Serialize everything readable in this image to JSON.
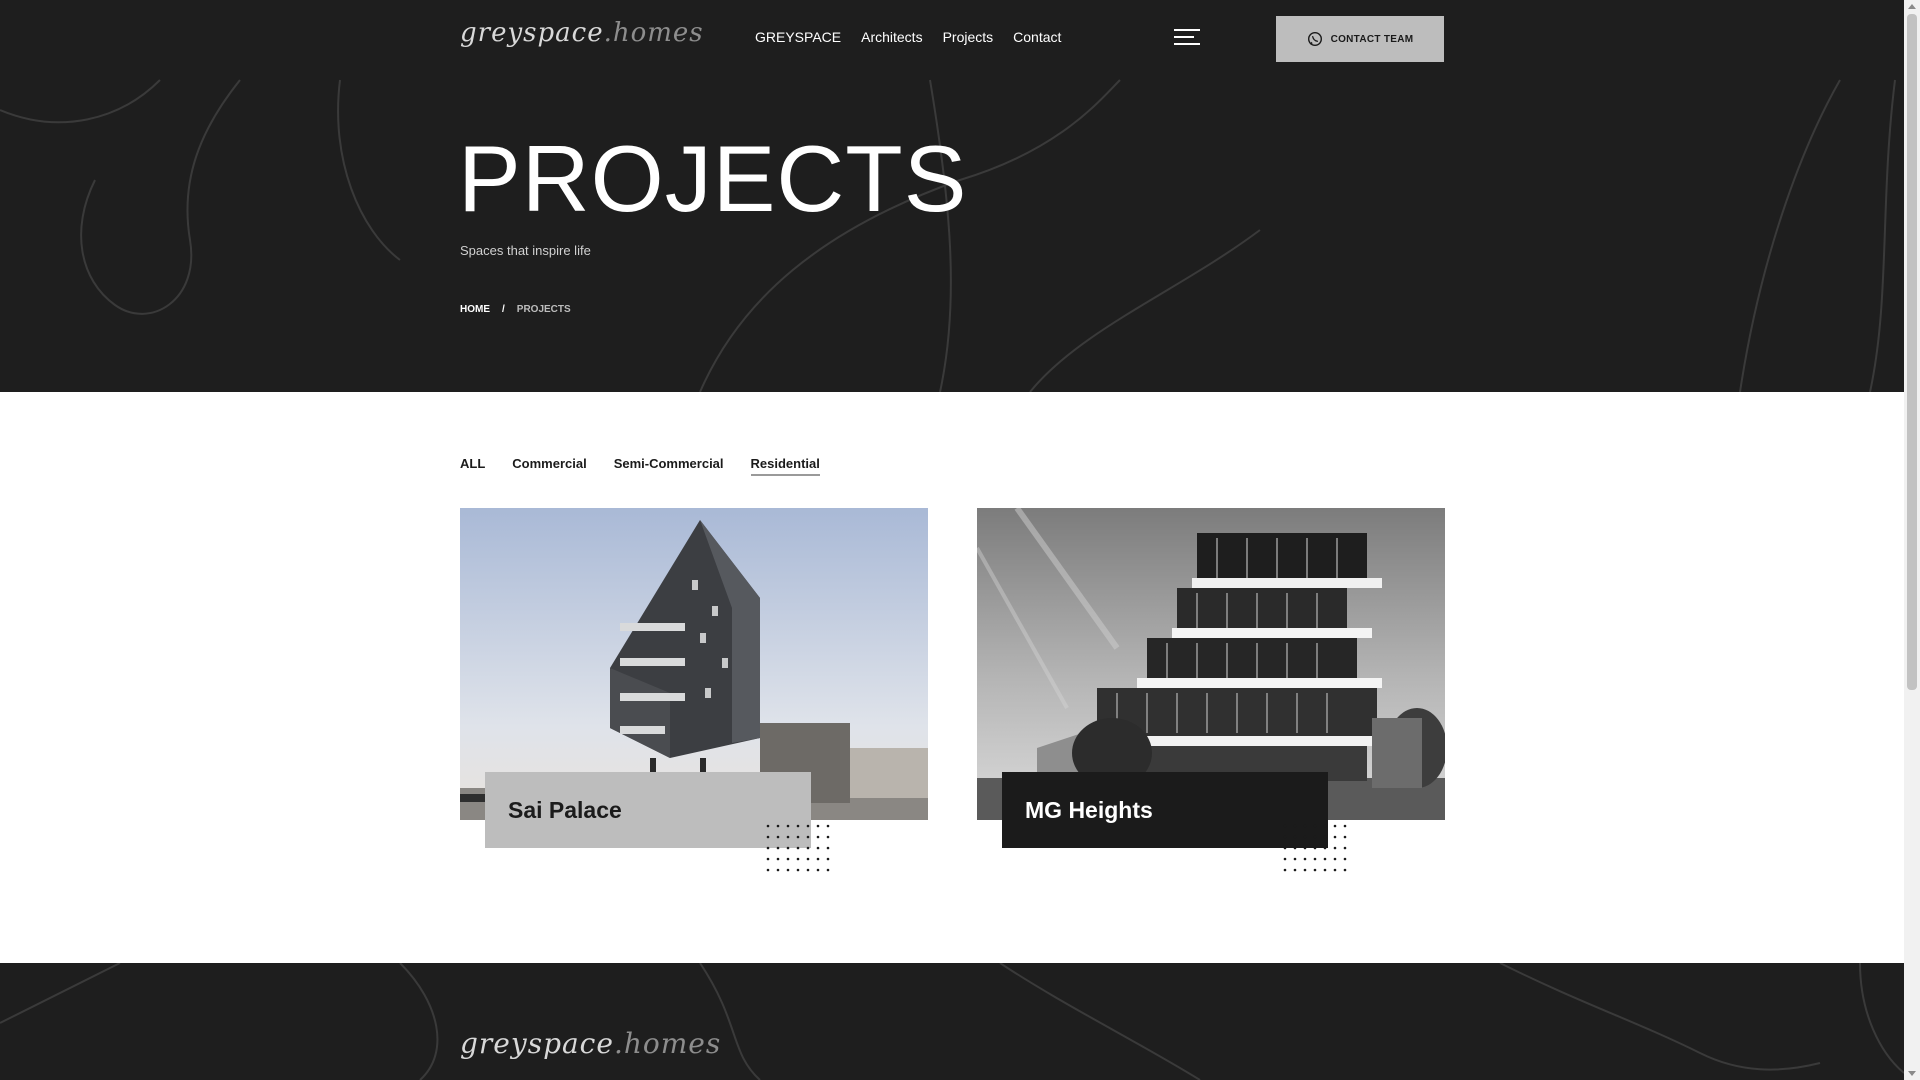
{
  "header": {
    "logo_primary": "greyspace",
    "logo_secondary": ".homes",
    "nav": [
      "GREYSPACE",
      "Architects",
      "Projects",
      "Contact"
    ],
    "menu_icon": "hamburger-icon",
    "contact_button": {
      "label": "CONTACT TEAM",
      "icon": "whatsapp-icon"
    }
  },
  "hero": {
    "title": "PROJECTS",
    "subtitle": "Spaces that inspire life",
    "breadcrumb": {
      "home": "HOME",
      "separator": "/",
      "current": "PROJECTS"
    }
  },
  "filters": {
    "items": [
      "ALL",
      "Commercial",
      "Semi-Commercial",
      "Residential"
    ],
    "active": "Residential"
  },
  "projects": [
    {
      "name": "Sai Palace"
    },
    {
      "name": "MG Heights"
    }
  ],
  "footer": {
    "logo_primary": "greyspace",
    "logo_secondary": ".homes"
  },
  "colors": {
    "dark_bg": "#1e1e1e",
    "button_grey": "#bdbdbd",
    "white": "#ffffff"
  }
}
